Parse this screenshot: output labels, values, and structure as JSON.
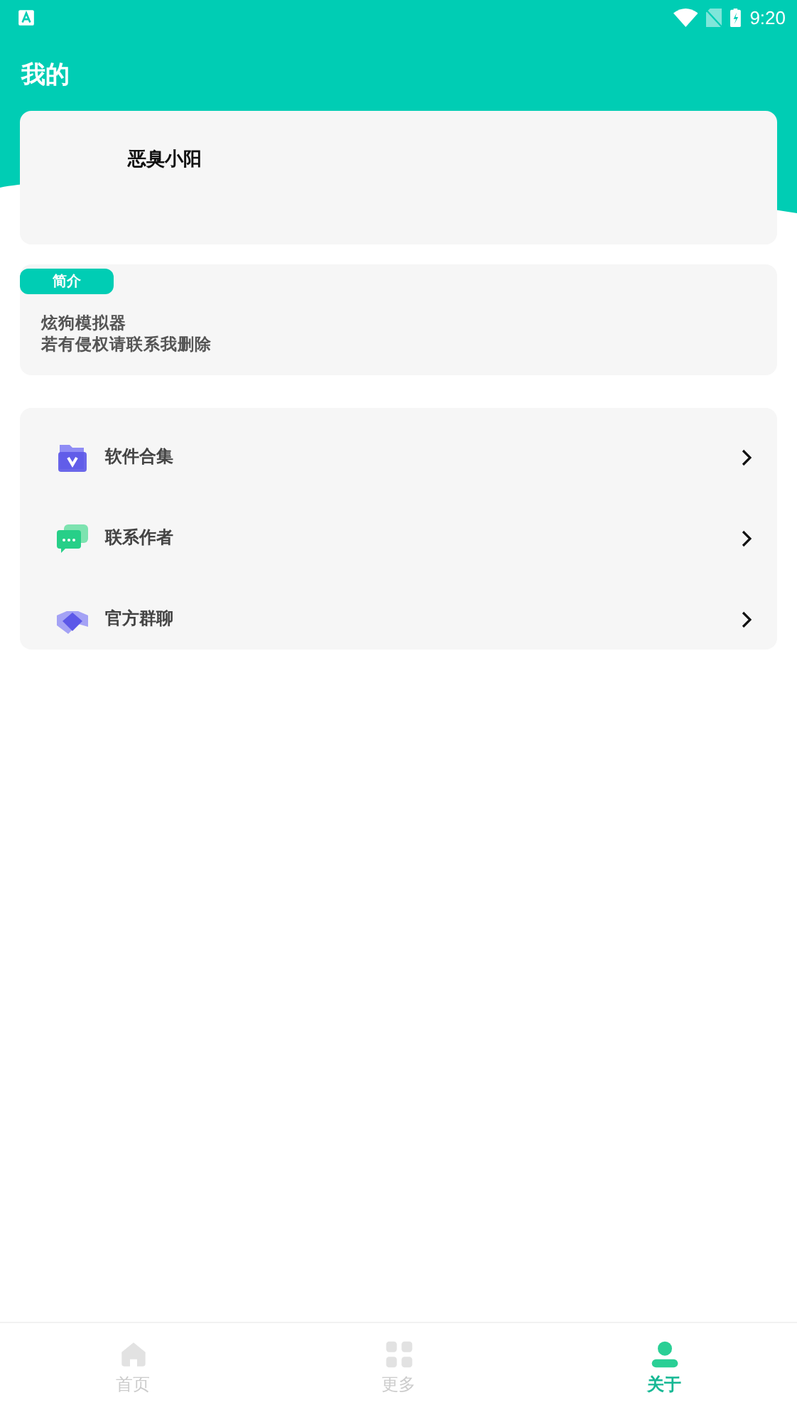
{
  "status_bar": {
    "time": "9:20"
  },
  "header": {
    "title": "我的"
  },
  "profile": {
    "name": "恶臭小阳"
  },
  "intro": {
    "badge": "简介",
    "lines": [
      "炫狗模拟器",
      "若有侵权请联系我删除"
    ]
  },
  "menu": [
    {
      "kind": "folder",
      "label": "软件合集"
    },
    {
      "kind": "chat",
      "label": "联系作者"
    },
    {
      "kind": "handshake",
      "label": "官方群聊"
    }
  ],
  "tabs": [
    {
      "kind": "home",
      "label": "首页",
      "selected": false
    },
    {
      "kind": "grid",
      "label": "更多",
      "selected": false
    },
    {
      "kind": "person",
      "label": "关于",
      "selected": true
    }
  ]
}
